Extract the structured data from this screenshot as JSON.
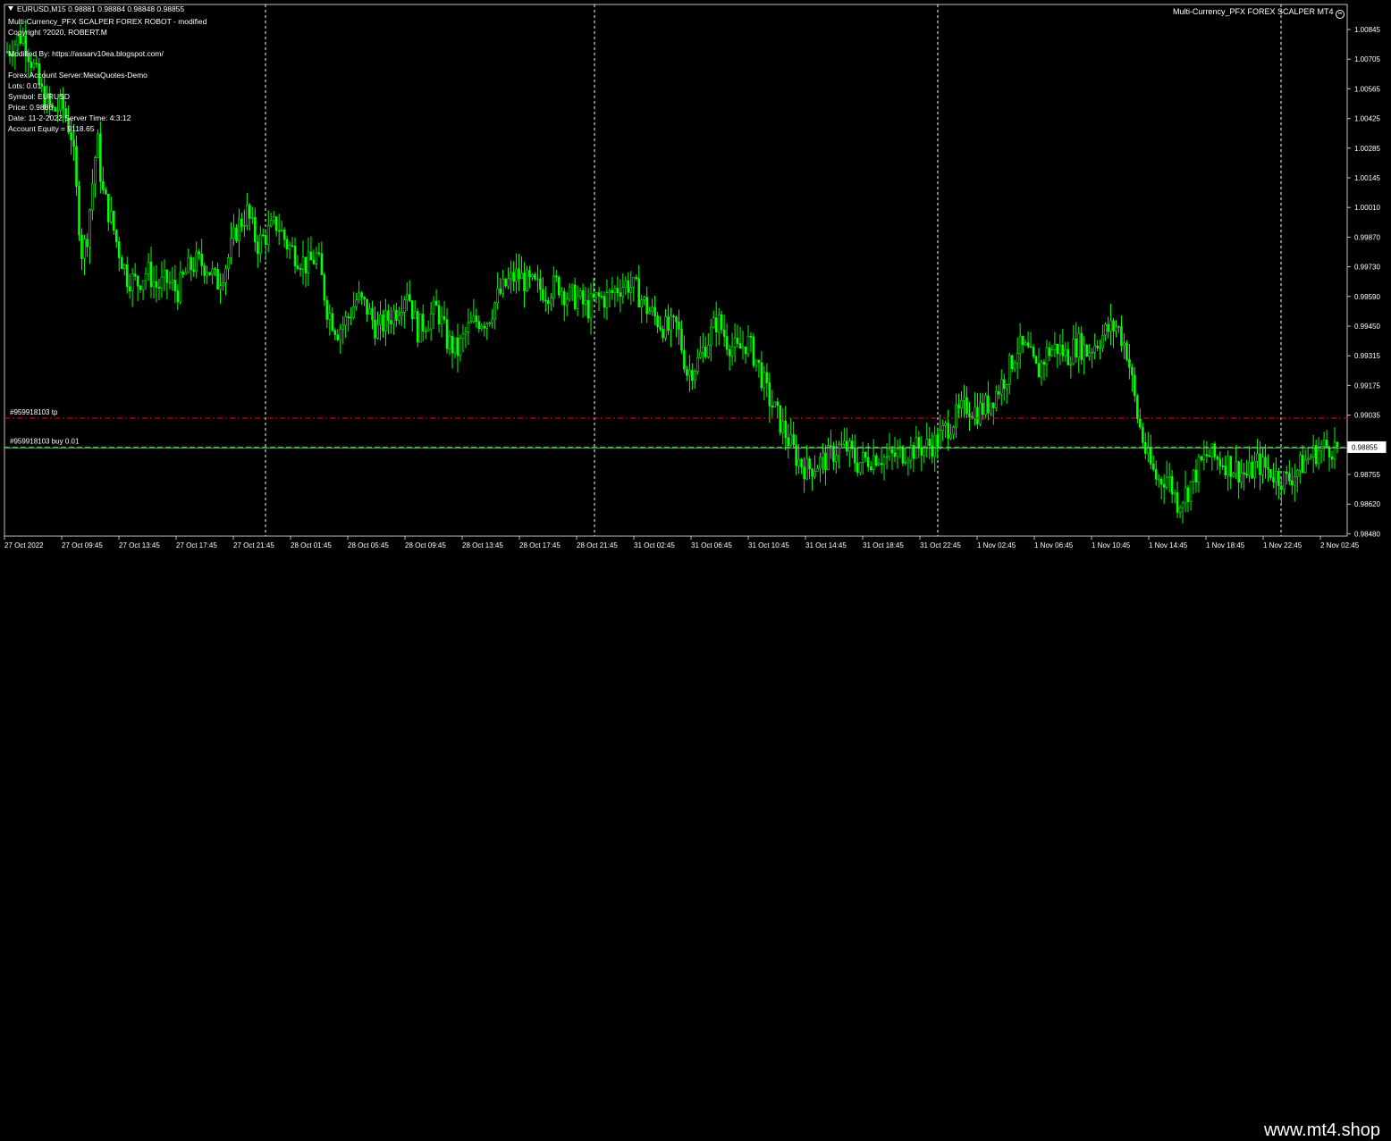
{
  "header": {
    "symbol_line": "EURUSD,M15  0.98881 0.98884 0.98848 0.98855",
    "robot_title": "Multi-Currency_PFX SCALPER FOREX ROBOT - modified",
    "copyright": "Copyright ?2020, ROBERT.M",
    "modified_by": "Modified By: https://assarv10ea.blogspot.com/",
    "server": "Forex Account Server:MetaQuotes-Demo",
    "lots": "Lots:  0.01",
    "symbol": "Symbol: EURUSD",
    "price": "Price:  0.9886",
    "date": "Date: 11-2-2022 Server Time: 4:3:12",
    "equity": "Account Equity = 9118.65"
  },
  "ea_name": "Multi-Currency_PFX FOREX SCALPER MT4",
  "smiley_icon": "smiley-face-icon",
  "orders": {
    "tp_label": "#959918103 tp",
    "buy_label": "#959918103 buy 0.01",
    "tp_price": 0.9899,
    "buy_price": 0.98855
  },
  "current_price": "0.98855",
  "watermark": "www.mt4.shop",
  "colors": {
    "candle": "#00ff00",
    "tp_line": "#ff0000",
    "buy_line": "#00ff00",
    "grid": "#ffffff",
    "background": "#000000"
  },
  "chart_data": {
    "type": "line",
    "symbol": "EURUSD",
    "timeframe": "M15",
    "price_axis_ticks": [
      "1.00845",
      "1.00705",
      "1.00565",
      "1.00425",
      "1.00285",
      "1.00145",
      "1.00010",
      "0.99870",
      "0.99730",
      "0.99590",
      "0.99450",
      "0.99315",
      "0.99175",
      "0.99035",
      "0.98895",
      "0.98755",
      "0.98620",
      "0.98480"
    ],
    "time_axis_ticks": [
      "27 Oct 2022",
      "27 Oct 09:45",
      "27 Oct 13:45",
      "27 Oct 17:45",
      "27 Oct 21:45",
      "28 Oct 01:45",
      "28 Oct 05:45",
      "28 Oct 09:45",
      "28 Oct 13:45",
      "28 Oct 17:45",
      "28 Oct 21:45",
      "31 Oct 02:45",
      "31 Oct 06:45",
      "31 Oct 10:45",
      "31 Oct 14:45",
      "31 Oct 18:45",
      "31 Oct 22:45",
      "1 Nov 02:45",
      "1 Nov 06:45",
      "1 Nov 10:45",
      "1 Nov 14:45",
      "1 Nov 18:45",
      "1 Nov 22:45",
      "2 Nov 02:45"
    ],
    "ylim": [
      0.9844,
      1.0092
    ],
    "close_path": [
      [
        0,
        1.007
      ],
      [
        3,
        1.0078
      ],
      [
        5,
        1.0065
      ],
      [
        7,
        1.005
      ],
      [
        9,
        1.0042
      ],
      [
        11,
        1.0045
      ],
      [
        13,
        1.003
      ],
      [
        14,
        1.0
      ],
      [
        15,
        0.9975
      ],
      [
        16,
        0.9985
      ],
      [
        18,
        1.003
      ],
      [
        19,
        1.0005
      ],
      [
        21,
        0.999
      ],
      [
        22,
        0.998
      ],
      [
        24,
        0.9965
      ],
      [
        26,
        0.9962
      ],
      [
        28,
        0.9968
      ],
      [
        30,
        0.996
      ],
      [
        32,
        0.9963
      ],
      [
        34,
        0.9958
      ],
      [
        36,
        0.9968
      ],
      [
        38,
        0.9972
      ],
      [
        40,
        0.997
      ],
      [
        42,
        0.9962
      ],
      [
        44,
        0.9972
      ],
      [
        46,
        0.9988
      ],
      [
        48,
        0.9995
      ],
      [
        50,
        0.998
      ],
      [
        52,
        0.9985
      ],
      [
        54,
        0.999
      ],
      [
        56,
        0.998
      ],
      [
        58,
        0.9975
      ],
      [
        60,
        0.997
      ],
      [
        62,
        0.9975
      ],
      [
        64,
        0.995
      ],
      [
        66,
        0.994
      ],
      [
        68,
        0.9945
      ],
      [
        70,
        0.9955
      ],
      [
        72,
        0.995
      ],
      [
        74,
        0.994
      ],
      [
        76,
        0.9945
      ],
      [
        78,
        0.995
      ],
      [
        80,
        0.996
      ],
      [
        82,
        0.994
      ],
      [
        84,
        0.9945
      ],
      [
        86,
        0.995
      ],
      [
        88,
        0.9935
      ],
      [
        90,
        0.993
      ],
      [
        92,
        0.994
      ],
      [
        94,
        0.9945
      ],
      [
        96,
        0.9945
      ],
      [
        98,
        0.9955
      ],
      [
        100,
        0.9962
      ],
      [
        102,
        0.9966
      ],
      [
        104,
        0.9962
      ],
      [
        106,
        0.996
      ],
      [
        108,
        0.9958
      ],
      [
        110,
        0.9962
      ],
      [
        112,
        0.9956
      ],
      [
        114,
        0.9955
      ],
      [
        116,
        0.995
      ],
      [
        118,
        0.9955
      ],
      [
        120,
        0.9955
      ],
      [
        122,
        0.996
      ],
      [
        124,
        0.9962
      ],
      [
        126,
        0.9958
      ],
      [
        128,
        0.995
      ],
      [
        130,
        0.9945
      ],
      [
        132,
        0.994
      ],
      [
        134,
        0.9942
      ],
      [
        136,
        0.992
      ],
      [
        138,
        0.9925
      ],
      [
        140,
        0.9935
      ],
      [
        142,
        0.9945
      ],
      [
        144,
        0.9935
      ],
      [
        146,
        0.993
      ],
      [
        148,
        0.9935
      ],
      [
        150,
        0.9925
      ],
      [
        152,
        0.991
      ],
      [
        154,
        0.99
      ],
      [
        156,
        0.989
      ],
      [
        158,
        0.988
      ],
      [
        160,
        0.9875
      ],
      [
        162,
        0.9878
      ],
      [
        164,
        0.988
      ],
      [
        166,
        0.9885
      ],
      [
        168,
        0.9885
      ],
      [
        170,
        0.9878
      ],
      [
        172,
        0.988
      ],
      [
        174,
        0.9882
      ],
      [
        176,
        0.988
      ],
      [
        178,
        0.9882
      ],
      [
        180,
        0.9884
      ],
      [
        182,
        0.9885
      ],
      [
        184,
        0.9886
      ],
      [
        186,
        0.9888
      ],
      [
        188,
        0.9895
      ],
      [
        190,
        0.99
      ],
      [
        192,
        0.9905
      ],
      [
        194,
        0.9902
      ],
      [
        196,
        0.9905
      ],
      [
        198,
        0.9912
      ],
      [
        200,
        0.992
      ],
      [
        202,
        0.9932
      ],
      [
        204,
        0.993
      ],
      [
        206,
        0.992
      ],
      [
        208,
        0.993
      ],
      [
        210,
        0.9932
      ],
      [
        212,
        0.9928
      ],
      [
        214,
        0.9934
      ],
      [
        216,
        0.993
      ],
      [
        218,
        0.9935
      ],
      [
        220,
        0.994
      ],
      [
        222,
        0.9942
      ],
      [
        224,
        0.993
      ],
      [
        226,
        0.99
      ],
      [
        228,
        0.988
      ],
      [
        230,
        0.987
      ],
      [
        232,
        0.9872
      ],
      [
        234,
        0.986
      ],
      [
        236,
        0.9865
      ],
      [
        238,
        0.9875
      ],
      [
        240,
        0.9882
      ],
      [
        242,
        0.988
      ],
      [
        244,
        0.9878
      ],
      [
        246,
        0.9875
      ],
      [
        248,
        0.9872
      ],
      [
        250,
        0.9878
      ],
      [
        252,
        0.9875
      ],
      [
        254,
        0.9872
      ],
      [
        256,
        0.987
      ],
      [
        258,
        0.9875
      ],
      [
        260,
        0.988
      ],
      [
        262,
        0.9884
      ],
      [
        264,
        0.9886
      ],
      [
        266,
        0.9885
      ]
    ]
  }
}
